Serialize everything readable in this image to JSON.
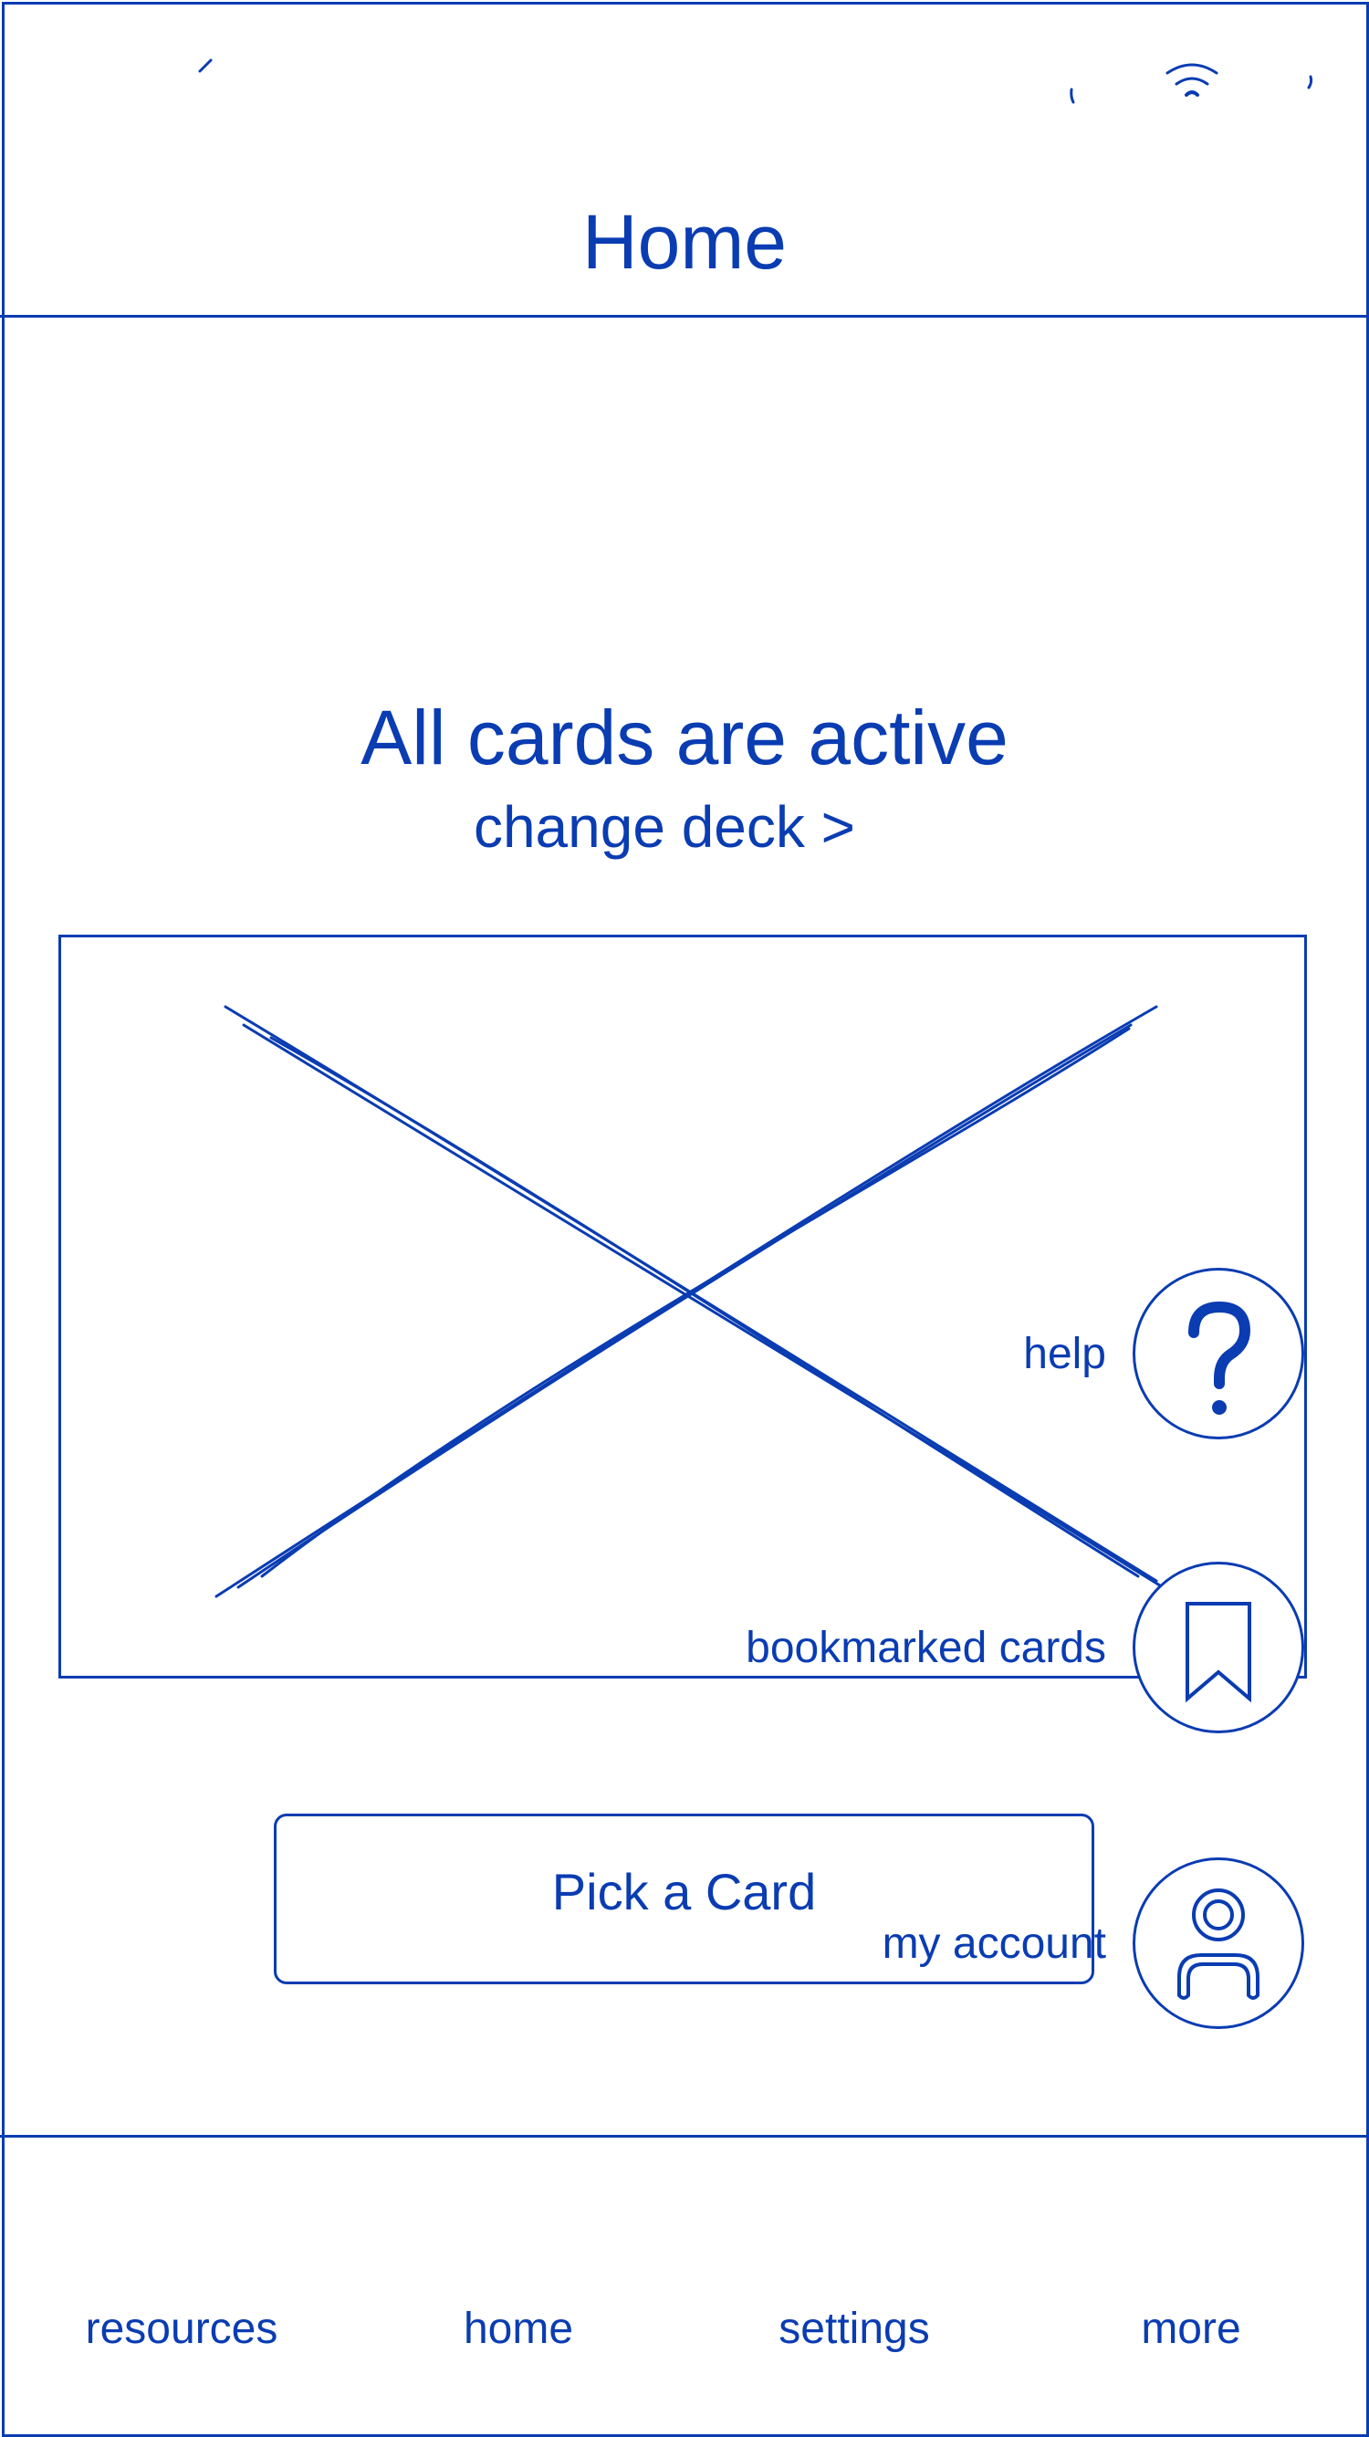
{
  "header": {
    "title": "Home"
  },
  "status_bar": {
    "icons": [
      "time-icon",
      "signal-icon",
      "wifi-icon",
      "battery-icon"
    ]
  },
  "main": {
    "deck_status": "All cards are active",
    "change_deck_link": "change deck >",
    "card_placeholder": "image-placeholder",
    "pick_button_label": "Pick a Card"
  },
  "fabs": [
    {
      "label": "help",
      "icon": "question-mark-icon"
    },
    {
      "label": "bookmarked cards",
      "icon": "bookmark-icon"
    },
    {
      "label": "my account",
      "icon": "person-icon"
    }
  ],
  "bottom_nav": {
    "items": [
      {
        "label": "resources"
      },
      {
        "label": "home"
      },
      {
        "label": "settings"
      },
      {
        "label": "more"
      }
    ]
  },
  "colors": {
    "accent": "#0a3cb2",
    "background": "#ffffff"
  }
}
